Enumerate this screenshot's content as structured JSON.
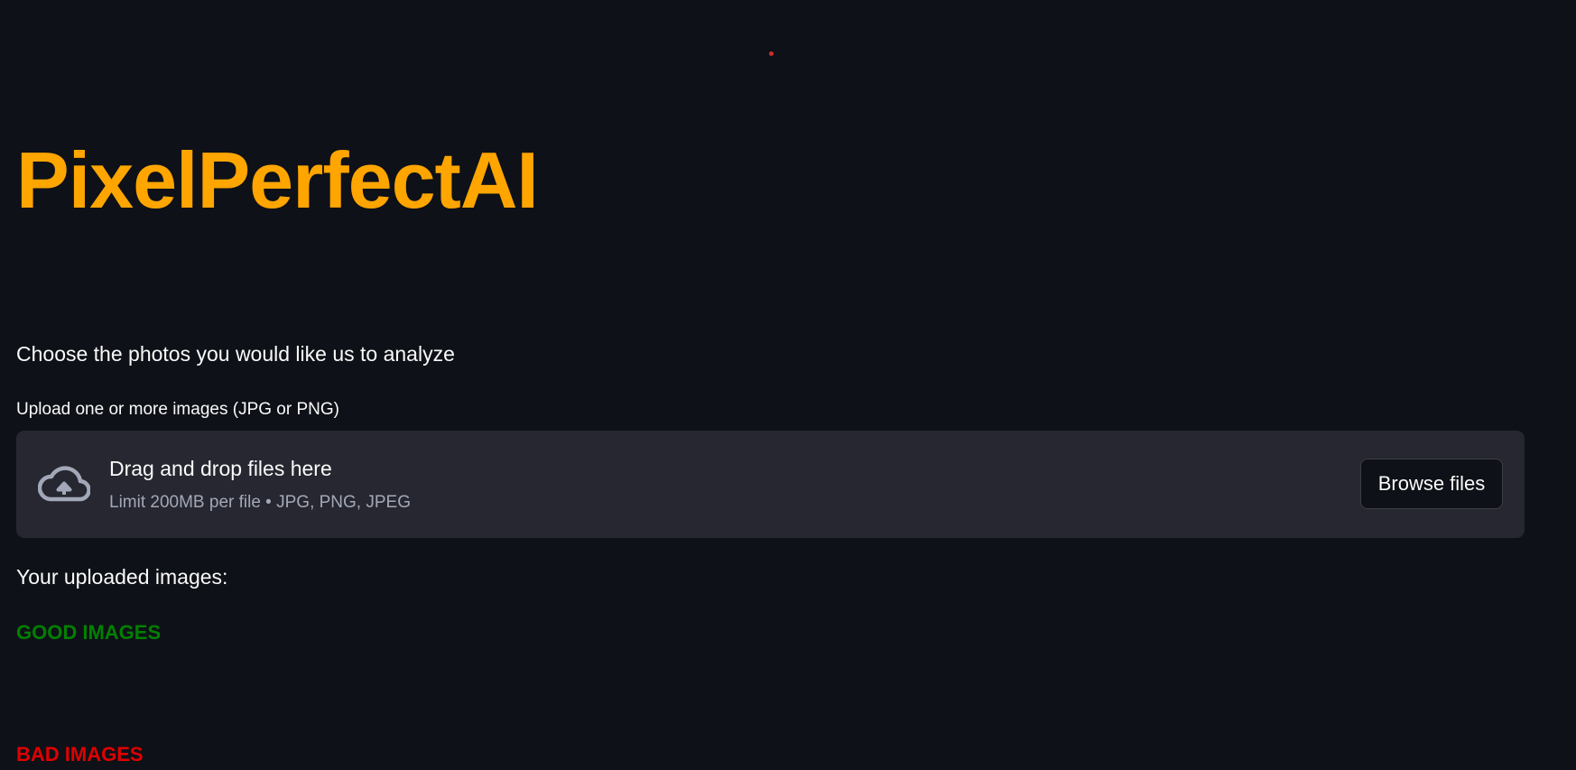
{
  "app": {
    "title": "PixelPerfectAI",
    "accent_color": "#ffa500",
    "status_indicator": "recording-dot-icon"
  },
  "intro": {
    "text": "Choose the photos you would like us to analyze"
  },
  "uploader": {
    "label": "Upload one or more images (JPG or PNG)",
    "drop_title": "Drag and drop files here",
    "drop_subtitle": "Limit 200MB per file • JPG, PNG, JPEG",
    "browse_label": "Browse files",
    "icon": "cloud-upload-icon"
  },
  "results": {
    "heading": "Your uploaded images:",
    "good_label": "GOOD IMAGES",
    "good_color": "#008000",
    "bad_label": "BAD IMAGES",
    "bad_color": "#e00000"
  }
}
